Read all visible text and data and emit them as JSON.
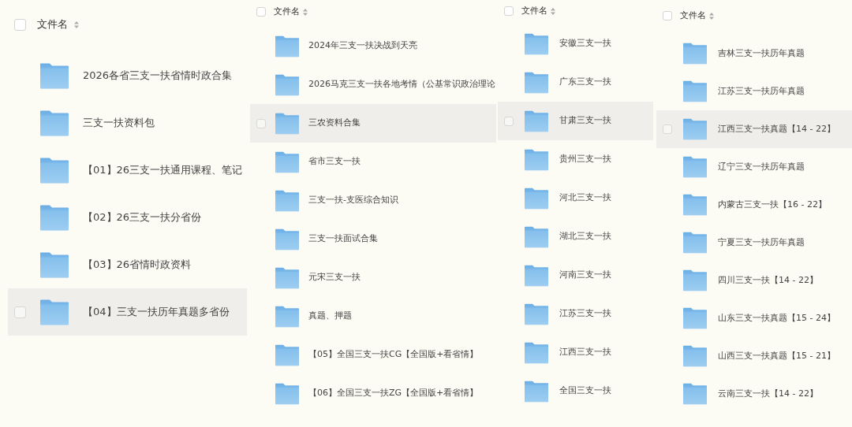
{
  "panels": [
    {
      "header": {
        "checked": false,
        "label": "文件名"
      },
      "items": [
        {
          "name": "2026各省三支一扶省情时政合集",
          "highlighted": false
        },
        {
          "name": "三支一扶资料包",
          "highlighted": false
        },
        {
          "name": "【01】26三支一扶通用课程、笔记",
          "highlighted": false
        },
        {
          "name": "【02】26三支一扶分省份",
          "highlighted": false
        },
        {
          "name": "【03】26省情时政资料",
          "highlighted": false
        },
        {
          "name": "【04】三支一扶历年真题多省份",
          "highlighted": true
        }
      ]
    },
    {
      "header": {
        "checked": false,
        "label": "文件名"
      },
      "items": [
        {
          "name": "2024年三支一扶决战到天亮",
          "highlighted": false
        },
        {
          "name": "2026马克三支一扶各地考情（公基常识政治理论",
          "highlighted": false
        },
        {
          "name": "三农资料合集",
          "highlighted": true
        },
        {
          "name": "省市三支一扶",
          "highlighted": false
        },
        {
          "name": "三支一扶-支医综合知识",
          "highlighted": false
        },
        {
          "name": "三支一扶面试合集",
          "highlighted": false
        },
        {
          "name": "元宋三支一扶",
          "highlighted": false
        },
        {
          "name": "真题、押题",
          "highlighted": false
        },
        {
          "name": "【05】全国三支一扶CG【全国版+看省情】",
          "highlighted": false
        },
        {
          "name": "【06】全国三支一扶ZG【全国版+看省情】",
          "highlighted": false
        }
      ]
    },
    {
      "header": {
        "checked": false,
        "label": "文件名"
      },
      "items": [
        {
          "name": "安徽三支一扶",
          "highlighted": false
        },
        {
          "name": "广东三支一扶",
          "highlighted": false
        },
        {
          "name": "甘肃三支一扶",
          "highlighted": true
        },
        {
          "name": "贵州三支一扶",
          "highlighted": false
        },
        {
          "name": "河北三支一扶",
          "highlighted": false
        },
        {
          "name": "湖北三支一扶",
          "highlighted": false
        },
        {
          "name": "河南三支一扶",
          "highlighted": false
        },
        {
          "name": "江苏三支一扶",
          "highlighted": false
        },
        {
          "name": "江西三支一扶",
          "highlighted": false
        },
        {
          "name": "全国三支一扶",
          "highlighted": false
        }
      ]
    },
    {
      "header": {
        "checked": false,
        "label": "文件名"
      },
      "items": [
        {
          "name": "吉林三支一扶历年真题",
          "highlighted": false
        },
        {
          "name": "江苏三支一扶历年真题",
          "highlighted": false
        },
        {
          "name": "江西三支一扶真题【14 - 22】",
          "highlighted": true
        },
        {
          "name": "辽宁三支一扶历年真题",
          "highlighted": false
        },
        {
          "name": "内蒙古三支一扶【16 - 22】",
          "highlighted": false
        },
        {
          "name": "宁夏三支一扶历年真题",
          "highlighted": false
        },
        {
          "name": "四川三支一扶【14 - 22】",
          "highlighted": false
        },
        {
          "name": "山东三支一扶真题【15 - 24】",
          "highlighted": false
        },
        {
          "name": "山西三支一扶真题【15 - 21】",
          "highlighted": false
        },
        {
          "name": "云南三支一扶【14 - 22】",
          "highlighted": false
        }
      ]
    }
  ]
}
